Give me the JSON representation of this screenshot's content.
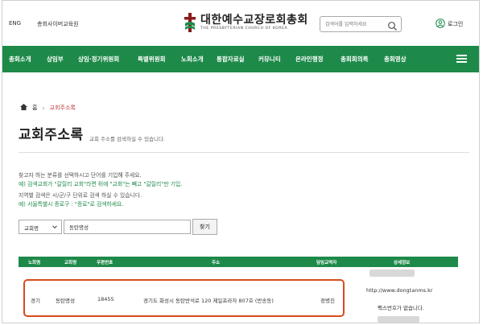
{
  "topbar": {
    "links": [
      "ENG",
      "총회사이버교육원"
    ],
    "logo_main": "대한예수교장로회총회",
    "logo_sub": "THE PRESBYTERIAN CHURCH OF KOREA",
    "search_placeholder": "검색어를 입력하세요",
    "login_label": "로그인"
  },
  "nav": {
    "items": [
      "총회소개",
      "상임부",
      "상임·정기위원회",
      "특별위원회",
      "노회소개",
      "통합자료실",
      "커뮤니티",
      "온라인행정",
      "총회회의록",
      "총회영상"
    ]
  },
  "breadcrumb": {
    "home": "홈",
    "current": "교회주소록"
  },
  "page": {
    "title": "교회주소록",
    "subtitle": "교회 주소를 검색하실 수 있습니다.",
    "guide": [
      "찾고자 하는 분류를 선택하시고 단어를 기입해 주세요.",
      "예) 검색교회가 \"갈릴리 교회\"라면 뒤에 \"교회\"는 빼고 \"갈릴리\"만 기입.",
      "지역별 검색은 시/군/구 단위로 검색 하실 수 있습니다.",
      "예) 서울특별시 종로구 : \"종로\"로 검색하세요."
    ]
  },
  "search_form": {
    "select_value": "교회명",
    "keyword_value": "동탄명성",
    "button_label": "찾기"
  },
  "table": {
    "headers": [
      "노회명",
      "교회명",
      "우편번호",
      "주소",
      "담임교역자",
      "상세정보"
    ],
    "row": {
      "presbytery": "경기",
      "church": "동탄명성",
      "zipcode": "18455",
      "address": "경기도 화성시 동탄반석로 120 제일프라자 807호 (반송동)",
      "pastor": "정병진",
      "homepage": "http://www.dongtanms.kr",
      "fax": "팩스번호가 없습니다."
    }
  },
  "colors": {
    "brand_green": "#1e8a4a",
    "highlight": "#d94b1e"
  }
}
